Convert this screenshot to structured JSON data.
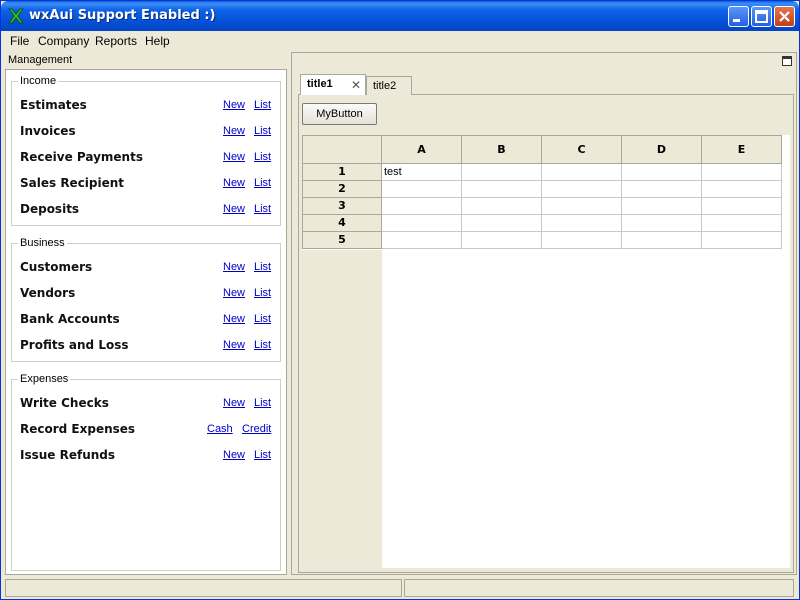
{
  "window": {
    "title": "wxAui Support Enabled :)"
  },
  "menubar": {
    "items": [
      "File",
      "Company",
      "Reports",
      "Help"
    ]
  },
  "left_pane": {
    "caption": "Management",
    "groups": [
      {
        "title": "Income",
        "rows": [
          {
            "label": "Estimates",
            "links": [
              "New",
              "List"
            ]
          },
          {
            "label": "Invoices",
            "links": [
              "New",
              "List"
            ]
          },
          {
            "label": "Receive Payments",
            "links": [
              "New",
              "List"
            ]
          },
          {
            "label": "Sales Recipient",
            "links": [
              "New",
              "List"
            ]
          },
          {
            "label": "Deposits",
            "links": [
              "New",
              "List"
            ]
          }
        ]
      },
      {
        "title": "Business",
        "rows": [
          {
            "label": "Customers",
            "links": [
              "New",
              "List"
            ]
          },
          {
            "label": "Vendors",
            "links": [
              "New",
              "List"
            ]
          },
          {
            "label": "Bank Accounts",
            "links": [
              "New",
              "List"
            ]
          },
          {
            "label": "Profits and Loss",
            "links": [
              "New",
              "List"
            ]
          }
        ]
      },
      {
        "title": "Expenses",
        "rows": [
          {
            "label": "Write Checks",
            "links": [
              "New",
              "List"
            ]
          },
          {
            "label": "Record Expenses",
            "links": [
              "Cash",
              "Credit"
            ]
          },
          {
            "label": "Issue Refunds",
            "links": [
              "New",
              "List"
            ]
          }
        ]
      }
    ]
  },
  "notebook": {
    "tabs": [
      {
        "label": "title1",
        "active": true
      },
      {
        "label": "title2",
        "active": false
      }
    ],
    "button_label": "MyButton",
    "grid": {
      "columns": [
        "A",
        "B",
        "C",
        "D",
        "E"
      ],
      "rows": [
        "1",
        "2",
        "3",
        "4",
        "5"
      ],
      "cells": [
        [
          "test",
          "",
          "",
          "",
          ""
        ],
        [
          "",
          "",
          "",
          "",
          ""
        ],
        [
          "",
          "",
          "",
          "",
          ""
        ],
        [
          "",
          "",
          "",
          "",
          ""
        ],
        [
          "",
          "",
          "",
          "",
          ""
        ]
      ]
    }
  },
  "colors": {
    "titlebar": "#0550d6",
    "link": "#0000cc",
    "chrome": "#ece9d8"
  },
  "icons": {
    "app": "wx-x-icon",
    "close_tab": "close-icon",
    "pane_maximize": "maximize-icon"
  }
}
